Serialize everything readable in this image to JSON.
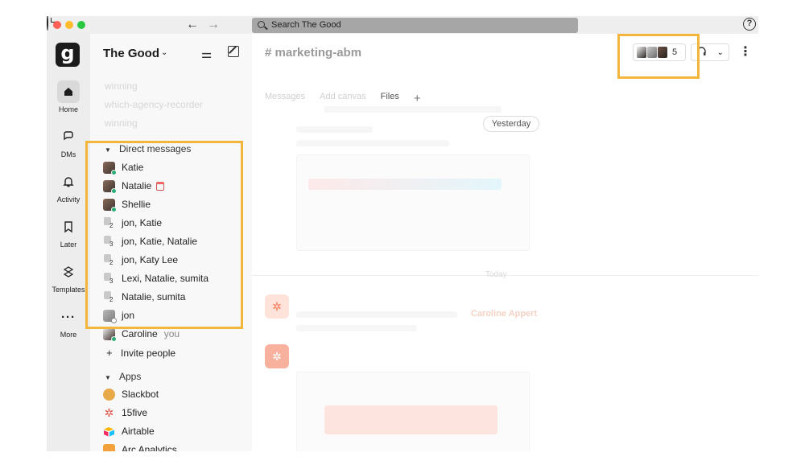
{
  "titlebar": {
    "search_placeholder": "Search The Good",
    "help_glyph": "?"
  },
  "workspace": {
    "logo_letter": "g",
    "name": "The Good"
  },
  "rail": {
    "items": [
      {
        "label": "Home",
        "icon": "home-icon"
      },
      {
        "label": "DMs",
        "icon": "dms-icon"
      },
      {
        "label": "Activity",
        "icon": "bell-icon"
      },
      {
        "label": "Later",
        "icon": "bookmark-icon"
      },
      {
        "label": "Templates",
        "icon": "templates-icon"
      },
      {
        "label": "More",
        "icon": "more-icon"
      }
    ]
  },
  "sidebar": {
    "faded_channels": [
      "winning",
      "which-agency-recorder",
      "winning"
    ],
    "dm_section": "Direct messages",
    "dms": [
      {
        "name": "Katie",
        "type": "photo",
        "presence": "active"
      },
      {
        "name": "Natalie",
        "type": "photo",
        "presence": "active",
        "status_emoji": "calendar-icon"
      },
      {
        "name": "Shellie",
        "type": "photo",
        "presence": "active"
      },
      {
        "name": "jon, Katie",
        "type": "group",
        "count": "2"
      },
      {
        "name": "jon, Katie, Natalie",
        "type": "group",
        "count": "3"
      },
      {
        "name": "jon, Katy Lee",
        "type": "group",
        "count": "2"
      },
      {
        "name": "Lexi, Natalie, sumita",
        "type": "group",
        "count": "3"
      },
      {
        "name": "Natalie, sumita",
        "type": "group",
        "count": "2"
      },
      {
        "name": "jon",
        "type": "photo",
        "presence": "away"
      },
      {
        "name": "Caroline",
        "type": "photo",
        "presence": "active",
        "suffix": "you"
      }
    ],
    "invite_label": "Invite people",
    "apps_section": "Apps",
    "apps": [
      {
        "name": "Slackbot",
        "icon": "slackbot-icon",
        "color": "#e8a94a"
      },
      {
        "name": "15five",
        "icon": "15five-icon",
        "color": "#e0544a"
      },
      {
        "name": "Airtable",
        "icon": "airtable-icon",
        "color": "#3e9be9"
      },
      {
        "name": "Arc Analytics",
        "icon": "arc-analytics-icon",
        "color": "#f3a13a"
      }
    ]
  },
  "main": {
    "channel_name": "# marketing-abm",
    "member_count": "5",
    "tabs": {
      "messages": "Messages",
      "add_canvas": "Add canvas",
      "files": "Files",
      "plus": "+"
    },
    "date_yesterday": "Yesterday",
    "date_today": "Today",
    "faded_mention": "Caroline Appert"
  },
  "colors": {
    "highlight": "#f3b53b",
    "presence_active": "#2bac76",
    "hubspot": "#ff7a59"
  }
}
